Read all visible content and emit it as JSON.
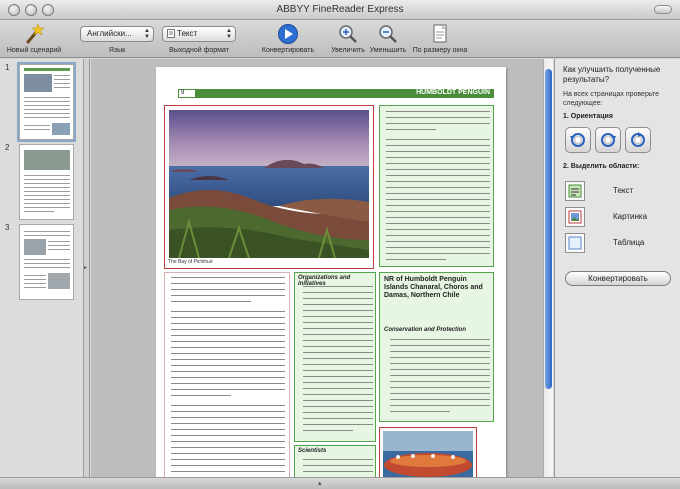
{
  "window": {
    "title": "ABBYY FineReader Express"
  },
  "toolbar": {
    "new_scenario_label": "Новый сценарий",
    "language_select_value": "Английски...",
    "language_label": "Язык",
    "format_select_value": "Текст",
    "format_label": "Выходной формат",
    "convert_label": "Конвертировать",
    "zoom_in_label": "Увеличить",
    "zoom_out_label": "Уменьшить",
    "fit_label": "По размеру окна"
  },
  "thumbnails": {
    "pages": [
      {
        "number": "1"
      },
      {
        "number": "2"
      },
      {
        "number": "3"
      }
    ]
  },
  "document": {
    "header_number": "9",
    "header_title": "HUMBOLDT PENGUIN",
    "photo_caption": "The Bay of Pichihué",
    "col2_heading": "Organizations and initiatives",
    "col2_heading2": "Scientists",
    "col3_heading": "NR of Humboldt Penguin Islands Chanaral, Choros and Damas, Northern Chile",
    "col3_heading2": "Conservation and Protection"
  },
  "right_panel": {
    "title": "Как улучшить полученные результаты?",
    "subtitle": "На всех страницах проверьте следующее:",
    "step1": "1. Ориентация",
    "step2": "2. Выделить области:",
    "area_text": "Текст",
    "area_picture": "Картинка",
    "area_table": "Таблица",
    "convert_button": "Конвертировать"
  },
  "colors": {
    "accent_green": "#4a8e3c",
    "zone_red": "#d54b4b",
    "scroll_blue": "#2c64c6"
  }
}
